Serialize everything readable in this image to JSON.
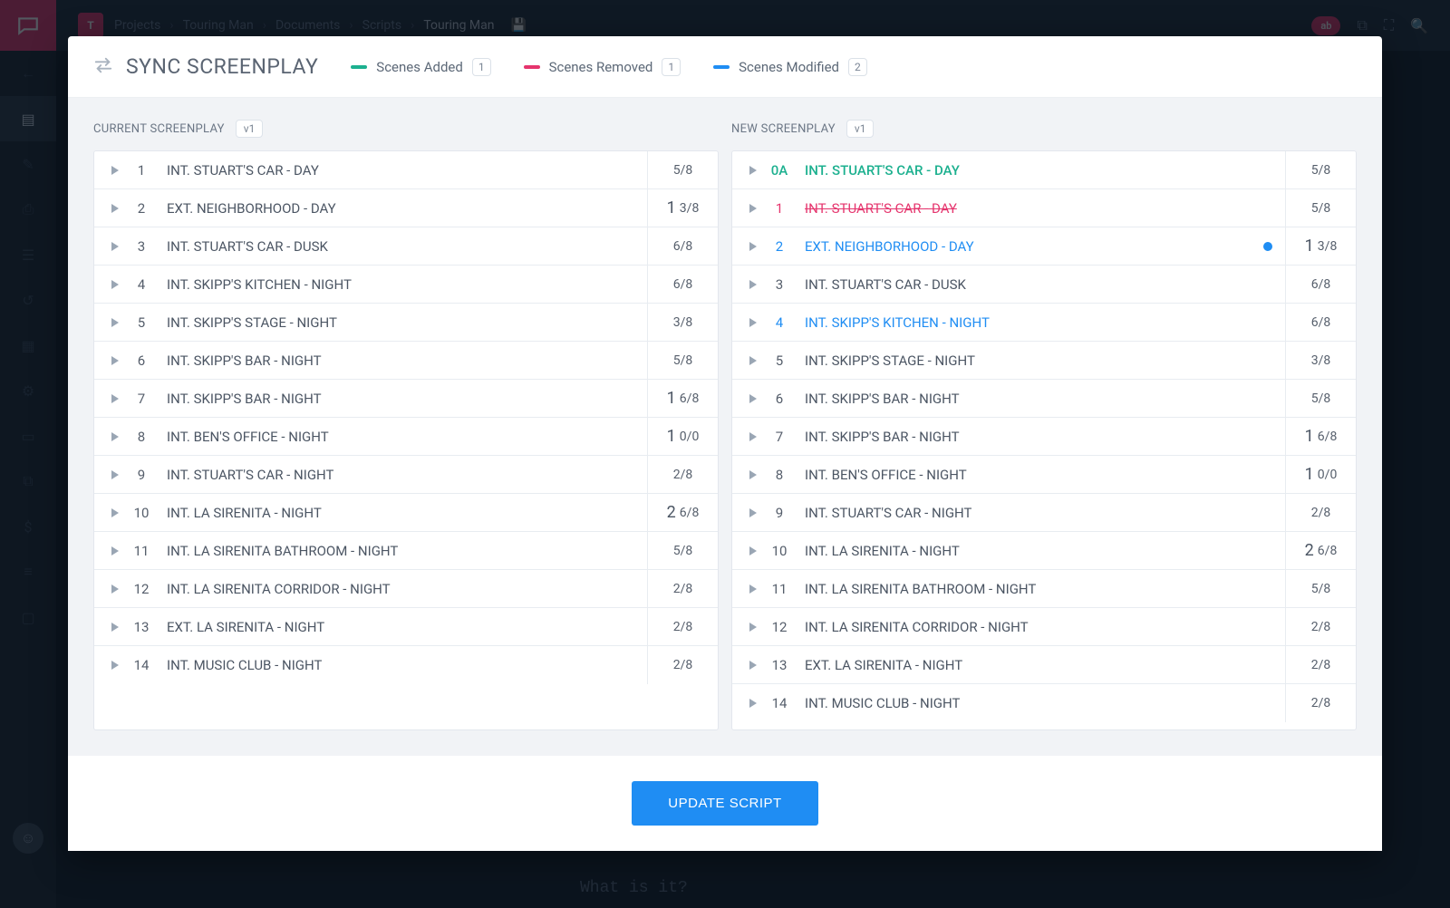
{
  "breadcrumb": {
    "proj_badge": "T",
    "items": [
      "Projects",
      "Touring Man",
      "Documents",
      "Scripts"
    ],
    "current": "Touring Man"
  },
  "topbar": {
    "user_badge": "ab"
  },
  "modal": {
    "title": "SYNC SCREENPLAY",
    "legend": {
      "added_label": "Scenes Added",
      "added_count": "1",
      "removed_label": "Scenes Removed",
      "removed_count": "1",
      "modified_label": "Scenes Modified",
      "modified_count": "2"
    },
    "update_label": "UPDATE SCRIPT"
  },
  "panels": {
    "current": {
      "title": "CURRENT SCREENPLAY",
      "version": "v1",
      "scenes": [
        {
          "num": "1",
          "title": "INT. STUART'S CAR - DAY",
          "pages": "5/8"
        },
        {
          "num": "2",
          "title": "EXT. NEIGHBORHOOD - DAY",
          "whole": "1",
          "pages": "3/8"
        },
        {
          "num": "3",
          "title": "INT. STUART'S CAR - DUSK",
          "pages": "6/8"
        },
        {
          "num": "4",
          "title": "INT. SKIPP'S KITCHEN - NIGHT",
          "pages": "6/8"
        },
        {
          "num": "5",
          "title": "INT. SKIPP'S STAGE - NIGHT",
          "pages": "3/8"
        },
        {
          "num": "6",
          "title": "INT. SKIPP'S BAR - NIGHT",
          "pages": "5/8"
        },
        {
          "num": "7",
          "title": "INT. SKIPP'S BAR - NIGHT",
          "whole": "1",
          "pages": "6/8"
        },
        {
          "num": "8",
          "title": "INT. BEN'S OFFICE - NIGHT",
          "whole": "1",
          "pages": "0/0"
        },
        {
          "num": "9",
          "title": "INT. STUART'S CAR - NIGHT",
          "pages": "2/8"
        },
        {
          "num": "10",
          "title": "INT. LA SIRENITA - NIGHT",
          "whole": "2",
          "pages": "6/8"
        },
        {
          "num": "11",
          "title": "INT. LA SIRENITA BATHROOM - NIGHT",
          "pages": "5/8"
        },
        {
          "num": "12",
          "title": "INT. LA SIRENITA CORRIDOR - NIGHT",
          "pages": "2/8"
        },
        {
          "num": "13",
          "title": "EXT. LA SIRENITA - NIGHT",
          "pages": "2/8"
        },
        {
          "num": "14",
          "title": "INT. MUSIC CLUB - NIGHT",
          "pages": "2/8"
        }
      ]
    },
    "new": {
      "title": "NEW SCREENPLAY",
      "version": "v1",
      "scenes": [
        {
          "num": "0A",
          "title": "INT. STUART'S CAR - DAY",
          "pages": "5/8",
          "status": "added"
        },
        {
          "num": "1",
          "title": "INT. STUART'S CAR - DAY",
          "pages": "5/8",
          "status": "removed"
        },
        {
          "num": "2",
          "title": "EXT. NEIGHBORHOOD - DAY",
          "whole": "1",
          "pages": "3/8",
          "status": "modified",
          "dot": true
        },
        {
          "num": "3",
          "title": "INT. STUART'S CAR - DUSK",
          "pages": "6/8"
        },
        {
          "num": "4",
          "title": "INT. SKIPP'S KITCHEN - NIGHT",
          "pages": "6/8",
          "status": "modified"
        },
        {
          "num": "5",
          "title": "INT. SKIPP'S STAGE - NIGHT",
          "pages": "3/8"
        },
        {
          "num": "6",
          "title": "INT. SKIPP'S BAR - NIGHT",
          "pages": "5/8"
        },
        {
          "num": "7",
          "title": "INT. SKIPP'S BAR - NIGHT",
          "whole": "1",
          "pages": "6/8"
        },
        {
          "num": "8",
          "title": "INT. BEN'S OFFICE - NIGHT",
          "whole": "1",
          "pages": "0/0"
        },
        {
          "num": "9",
          "title": "INT. STUART'S CAR - NIGHT",
          "pages": "2/8"
        },
        {
          "num": "10",
          "title": "INT. LA SIRENITA - NIGHT",
          "whole": "2",
          "pages": "6/8"
        },
        {
          "num": "11",
          "title": "INT. LA SIRENITA BATHROOM - NIGHT",
          "pages": "5/8"
        },
        {
          "num": "12",
          "title": "INT. LA SIRENITA CORRIDOR - NIGHT",
          "pages": "2/8"
        },
        {
          "num": "13",
          "title": "EXT. LA SIRENITA - NIGHT",
          "pages": "2/8"
        },
        {
          "num": "14",
          "title": "INT. MUSIC CLUB - NIGHT",
          "pages": "2/8"
        }
      ]
    }
  }
}
